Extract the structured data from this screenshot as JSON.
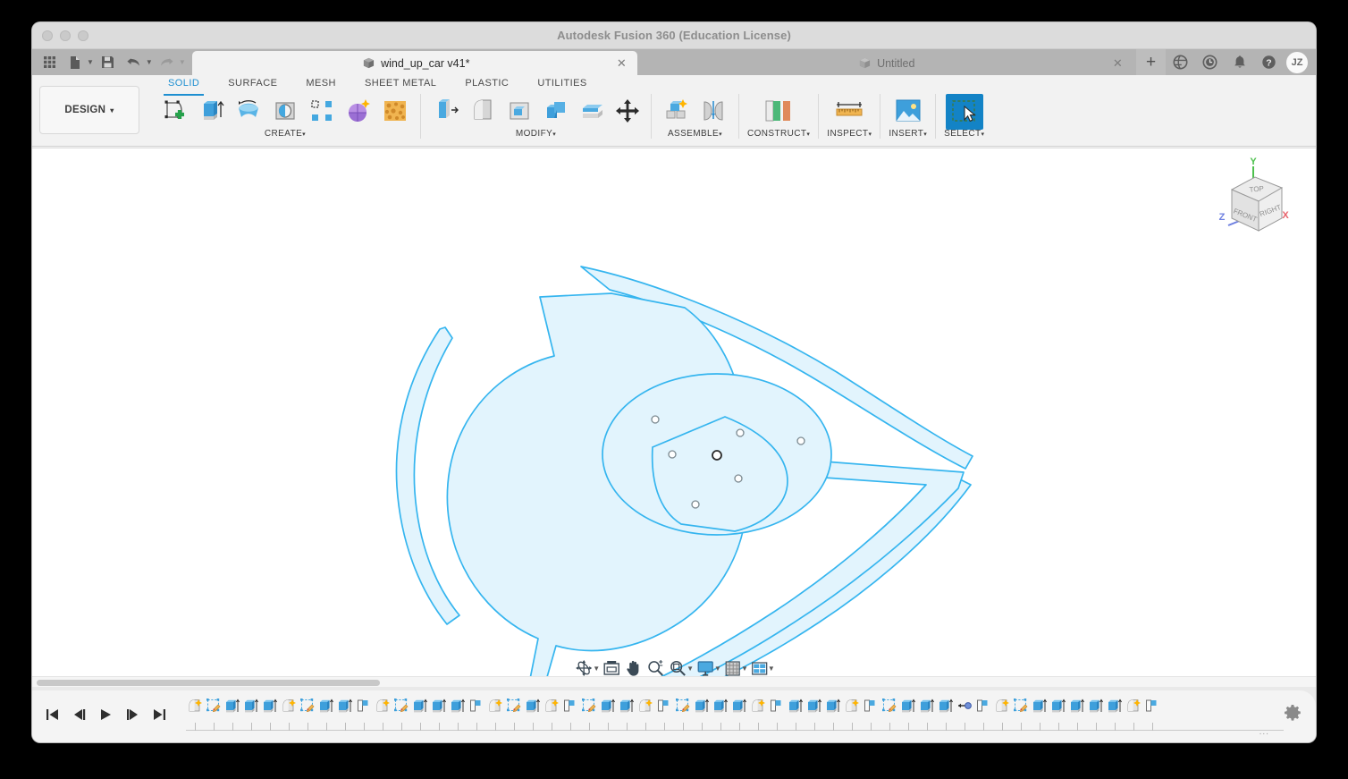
{
  "window": {
    "app_title": "Autodesk Fusion 360 (Education License)",
    "traffic_lights": [
      "close",
      "minimize",
      "zoom"
    ]
  },
  "quick_access": [
    {
      "name": "show-data-panel",
      "icon": "grid-icon",
      "enabled": true
    },
    {
      "name": "file-menu",
      "icon": "file-icon",
      "enabled": true,
      "caret": true
    },
    {
      "name": "save",
      "icon": "save-icon",
      "enabled": true
    },
    {
      "name": "undo",
      "icon": "undo-arrow-icon",
      "enabled": true,
      "caret": true
    },
    {
      "name": "redo",
      "icon": "redo-arrow-icon",
      "enabled": false,
      "caret": true
    }
  ],
  "tabs": [
    {
      "label": "wind_up_car v41*",
      "active": true,
      "icon": "cube-icon",
      "close": "✕"
    },
    {
      "label": "Untitled",
      "active": false,
      "icon": "cube-icon",
      "close": "✕"
    }
  ],
  "tab_tools": [
    {
      "name": "new-tab",
      "icon": "plus-icon",
      "glyph": "+"
    },
    {
      "name": "job-status",
      "icon": "globe-icon"
    },
    {
      "name": "recent-activity",
      "icon": "clock-icon"
    },
    {
      "name": "notifications",
      "icon": "bell-icon"
    },
    {
      "name": "help",
      "icon": "question-mark-icon"
    }
  ],
  "account": {
    "initials": "JZ"
  },
  "workspace": {
    "label": "DESIGN",
    "caret": "▾"
  },
  "ribbon_tabs": [
    {
      "label": "SOLID",
      "active": true
    },
    {
      "label": "SURFACE",
      "active": false
    },
    {
      "label": "MESH",
      "active": false
    },
    {
      "label": "SHEET METAL",
      "active": false
    },
    {
      "label": "PLASTIC",
      "active": false
    },
    {
      "label": "UTILITIES",
      "active": false
    }
  ],
  "panels": [
    {
      "label": "CREATE",
      "caret": "▾",
      "tools": [
        {
          "name": "create-sketch",
          "icon": "sketch-plus-icon"
        },
        {
          "name": "extrude",
          "icon": "extrude-icon"
        },
        {
          "name": "revolve",
          "icon": "revolve-icon"
        },
        {
          "name": "hole",
          "icon": "hole-icon"
        },
        {
          "name": "rectangular-pattern",
          "icon": "pattern-icon"
        },
        {
          "name": "create-form",
          "icon": "form-sculpt-icon"
        },
        {
          "name": "create-mesh",
          "icon": "mesh-icon"
        }
      ]
    },
    {
      "label": "MODIFY",
      "caret": "▾",
      "tools": [
        {
          "name": "press-pull",
          "icon": "press-pull-icon"
        },
        {
          "name": "fillet",
          "icon": "fillet-icon"
        },
        {
          "name": "shell",
          "icon": "shell-icon"
        },
        {
          "name": "combine",
          "icon": "combine-icon"
        },
        {
          "name": "offset-face",
          "icon": "offset-face-icon"
        },
        {
          "name": "move-copy",
          "icon": "move-arrows-icon"
        }
      ]
    },
    {
      "label": "ASSEMBLE",
      "caret": "▾",
      "tools": [
        {
          "name": "new-component",
          "icon": "new-component-icon"
        },
        {
          "name": "joint",
          "icon": "joint-icon"
        }
      ]
    },
    {
      "label": "CONSTRUCT",
      "caret": "▾",
      "tools": [
        {
          "name": "offset-plane",
          "icon": "construct-plane-icon"
        }
      ]
    },
    {
      "label": "INSPECT",
      "caret": "▾",
      "tools": [
        {
          "name": "measure",
          "icon": "ruler-icon"
        }
      ]
    },
    {
      "label": "INSERT",
      "caret": "▾",
      "tools": [
        {
          "name": "insert-canvas",
          "icon": "image-icon"
        }
      ]
    },
    {
      "label": "SELECT",
      "caret": "▾",
      "selected": true,
      "tools": [
        {
          "name": "select-tool",
          "icon": "cursor-select-icon"
        }
      ]
    }
  ],
  "view_cube": {
    "faces": [
      "TOP",
      "FRONT",
      "RIGHT"
    ],
    "axes": [
      {
        "label": "X",
        "color": "#e8616a"
      },
      {
        "label": "Y",
        "color": "#4dc04d"
      },
      {
        "label": "Z",
        "color": "#6d7fe0"
      }
    ]
  },
  "navigation_bar": [
    {
      "name": "orbit",
      "icon": "orbit-icon",
      "caret": true
    },
    {
      "name": "look-at",
      "icon": "look-at-icon",
      "caret": false
    },
    {
      "name": "pan",
      "icon": "hand-pan-icon",
      "caret": false
    },
    {
      "name": "zoom",
      "icon": "zoom-magnifier-icon",
      "caret": false
    },
    {
      "name": "zoom-window",
      "icon": "zoom-window-icon",
      "caret": true
    },
    {
      "name": "display-settings",
      "icon": "monitor-icon",
      "caret": true
    },
    {
      "name": "grid-snaps",
      "icon": "grid-settings-icon",
      "caret": true
    },
    {
      "name": "viewports",
      "icon": "viewport-layout-icon",
      "caret": true
    }
  ],
  "timeline": {
    "playback": [
      {
        "name": "go-to-beginning",
        "icon": "skip-start-icon"
      },
      {
        "name": "step-back",
        "icon": "step-back-icon"
      },
      {
        "name": "play-forward",
        "icon": "play-icon"
      },
      {
        "name": "step-forward",
        "icon": "step-forward-icon"
      },
      {
        "name": "go-to-end",
        "icon": "skip-end-icon"
      }
    ],
    "settings": {
      "name": "timeline-settings",
      "icon": "gear-icon"
    },
    "overflow": "...",
    "features": [
      {
        "icon": "fillet-icon"
      },
      {
        "icon": "sketch-icon"
      },
      {
        "icon": "extrude-icon"
      },
      {
        "icon": "extrude-icon"
      },
      {
        "icon": "extrude-icon"
      },
      {
        "icon": "fillet-icon"
      },
      {
        "icon": "sketch-icon"
      },
      {
        "icon": "extrude-icon"
      },
      {
        "icon": "extrude-icon"
      },
      {
        "icon": "plane-icon"
      },
      {
        "icon": "fillet-icon"
      },
      {
        "icon": "sketch-icon"
      },
      {
        "icon": "extrude-icon"
      },
      {
        "icon": "extrude-icon"
      },
      {
        "icon": "extrude-icon"
      },
      {
        "icon": "plane-icon"
      },
      {
        "icon": "fillet-icon"
      },
      {
        "icon": "sketch-icon"
      },
      {
        "icon": "extrude-icon"
      },
      {
        "icon": "fillet-icon"
      },
      {
        "icon": "plane-icon"
      },
      {
        "icon": "sketch-icon"
      },
      {
        "icon": "extrude-icon"
      },
      {
        "icon": "extrude-icon"
      },
      {
        "icon": "fillet-icon"
      },
      {
        "icon": "plane-icon"
      },
      {
        "icon": "sketch-icon"
      },
      {
        "icon": "extrude-icon"
      },
      {
        "icon": "extrude-icon"
      },
      {
        "icon": "extrude-icon"
      },
      {
        "icon": "fillet-icon"
      },
      {
        "icon": "plane-icon"
      },
      {
        "icon": "extrude-icon"
      },
      {
        "icon": "extrude-icon"
      },
      {
        "icon": "extrude-icon"
      },
      {
        "icon": "fillet-icon"
      },
      {
        "icon": "plane-icon"
      },
      {
        "icon": "sketch-icon"
      },
      {
        "icon": "extrude-icon"
      },
      {
        "icon": "extrude-icon"
      },
      {
        "icon": "extrude-icon"
      },
      {
        "icon": "joint-icon"
      },
      {
        "icon": "plane-icon"
      },
      {
        "icon": "fillet-icon"
      },
      {
        "icon": "sketch-icon"
      },
      {
        "icon": "extrude-icon"
      },
      {
        "icon": "extrude-icon"
      },
      {
        "icon": "extrude-icon"
      },
      {
        "icon": "extrude-icon"
      },
      {
        "icon": "extrude-icon"
      },
      {
        "icon": "fillet-icon"
      },
      {
        "icon": "plane-icon"
      }
    ]
  },
  "model": {
    "name": "three-blade-propeller-sketch",
    "fill_color": "#e2f4fd",
    "stroke_color": "#35b5ef",
    "hub_holes": 7
  },
  "canvas": {
    "background": "#ffffff"
  }
}
